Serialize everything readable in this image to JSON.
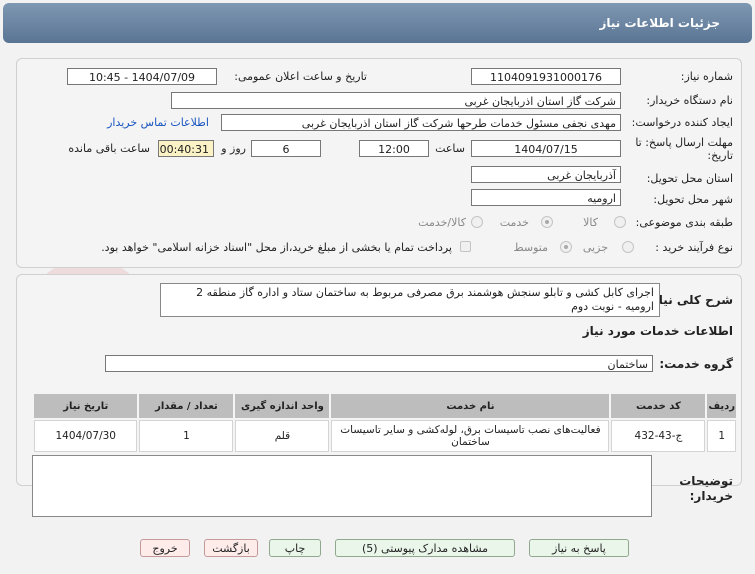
{
  "title": "جزئیات اطلاعات نیاز",
  "fields": {
    "need_number_label": "شماره نیاز:",
    "need_number": "1104091931000176",
    "announce_label": "تاریخ و ساعت اعلان عمومی:",
    "announce_value": "1404/07/09 - 10:45",
    "buyer_label": "نام دستگاه خریدار:",
    "buyer_value": "شرکت گاز استان اذربایجان غربی",
    "creator_label": "ایجاد کننده درخواست:",
    "creator_value": "مهدی نجفی مسئول خدمات طرحها شرکت گاز استان اذربایجان غربی",
    "contact_link": "اطلاعات تماس خریدار",
    "deadline_label": "مهلت ارسال پاسخ: تا تاریخ:",
    "deadline_date": "1404/07/15",
    "time_label": "ساعت",
    "deadline_time": "12:00",
    "days_value": "6",
    "days_label": "روز و",
    "remaining_time": "00:40:31",
    "remaining_label": "ساعت باقی مانده",
    "province_label": "استان محل تحویل:",
    "province_value": "آذربایجان غربی",
    "city_label": "شهر محل تحویل:",
    "city_value": "ارومیه",
    "category_label": "طبقه بندی موضوعی:",
    "category_options": [
      "کالا",
      "خدمت",
      "کالا/خدمت"
    ],
    "process_label": "نوع فرآیند خرید :",
    "process_options": [
      "جزیی",
      "متوسط"
    ],
    "payment_note": "پرداخت تمام یا بخشی از مبلغ خرید،از محل \"اسناد خزانه اسلامی\" خواهد بود."
  },
  "details": {
    "description_label": "شرح کلی نیاز:",
    "description_value": "اجرای کابل کشی و تابلو سنجش هوشمند برق مصرفی مربوط به ساختمان ستاد و اداره گاز منطقه 2 ارومیه - نوبت دوم",
    "services_heading": "اطلاعات خدمات مورد نیاز",
    "service_group_label": "گروه خدمت:",
    "service_group_value": "ساختمان",
    "buyer_notes_label": "توضیحات خریدار:"
  },
  "table": {
    "headers": [
      "ردیف",
      "کد خدمت",
      "نام خدمت",
      "واحد اندازه گیری",
      "تعداد / مقدار",
      "تاریخ نیاز"
    ],
    "rows": [
      [
        "1",
        "ج-43-432",
        "فعالیت‌های نصب تاسیسات برق، لوله‌کشی و سایر تاسیسات ساختمان",
        "قلم",
        "1",
        "1404/07/30"
      ]
    ]
  },
  "buttons": {
    "reply": "پاسخ به نیاز",
    "attachments": "مشاهده مدارک پیوستی (5)",
    "print": "چاپ",
    "back": "بازگشت",
    "exit": "خروج"
  },
  "watermark_text": "AriaTender.net"
}
